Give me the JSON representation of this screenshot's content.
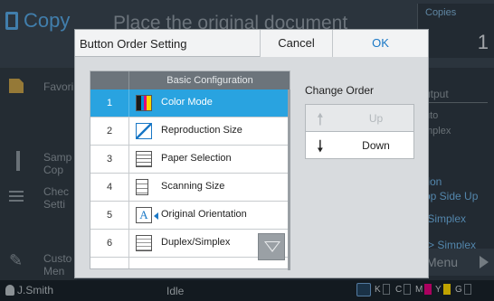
{
  "background": {
    "app_title": "Copy",
    "message": "Place the original document",
    "copies_label": "Copies",
    "copies_value": "1",
    "side_items": [
      {
        "label": "Favori",
        "icon": "favorite-folder-icon"
      },
      {
        "label": "Samp\nCop",
        "icon": "sample-copy-icon"
      },
      {
        "label": "Chec\nSetti",
        "icon": "check-settings-icon"
      },
      {
        "label": "Custo\nMen",
        "icon": "wrench-icon"
      }
    ],
    "right_panel": {
      "output": "utput",
      "line1": "uto",
      "line2": "mplex",
      "line3": "tion",
      "line4": "op Side Up",
      "line5": "/Simplex",
      "line6": "-> Simplex",
      "menu": "Menu"
    },
    "status": {
      "user": "J.Smith",
      "state": "Idle",
      "toner": [
        "K",
        "C",
        "M",
        "Y",
        "G"
      ],
      "toner_colors": [
        "#222222",
        "#00a0e9",
        "#e4007f",
        "#ffd900",
        "#9a9a9a"
      ]
    }
  },
  "dialog": {
    "title": "Button Order Setting",
    "cancel_label": "Cancel",
    "ok_label": "OK",
    "list_header": "Basic Configuration",
    "items": [
      {
        "num": "1",
        "label": "Color Mode",
        "icon": "color-mode-icon"
      },
      {
        "num": "2",
        "label": "Reproduction Size",
        "icon": "reproduction-size-icon"
      },
      {
        "num": "3",
        "label": "Paper Selection",
        "icon": "paper-selection-icon"
      },
      {
        "num": "4",
        "label": "Scanning Size",
        "icon": "scanning-size-icon"
      },
      {
        "num": "5",
        "label": "Original Orientation",
        "icon": "original-orientation-icon"
      },
      {
        "num": "6",
        "label": "Duplex/Simplex",
        "icon": "duplex-simplex-icon"
      }
    ],
    "selected_index": 0,
    "change_order_label": "Change Order",
    "up_label": "Up",
    "down_label": "Down",
    "up_arrow": "🠕",
    "down_arrow": "🠗",
    "orientation_glyph": "A"
  }
}
